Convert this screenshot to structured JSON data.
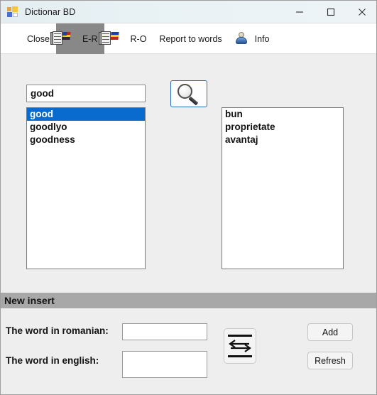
{
  "window": {
    "title": "Dictionar BD",
    "icon": "app-form-icon",
    "controls": {
      "minimize": "minimize-icon",
      "maximize": "maximize-icon",
      "close": "close-icon"
    }
  },
  "toolbar": {
    "items": [
      {
        "label": "Close",
        "icon": "power-icon",
        "selected": false
      },
      {
        "label": "E-R",
        "icon": "english-book-icon",
        "selected": true
      },
      {
        "label": "R-O",
        "icon": "romanian-book-icon",
        "selected": false
      },
      {
        "label": "Report to words",
        "icon": "",
        "selected": false
      },
      {
        "label": "Info",
        "icon": "person-icon",
        "selected": false
      }
    ]
  },
  "search": {
    "value": "good",
    "placeholder": "",
    "button_icon": "magnifier-icon"
  },
  "results": {
    "source_list": {
      "items": [
        "good",
        "goodlyo",
        "goodness"
      ],
      "selected_index": 0
    },
    "target_list": {
      "items": [
        "bun",
        "proprietate",
        "avantaj"
      ],
      "selected_index": -1
    }
  },
  "new_insert": {
    "section_title": "New insert",
    "romanian_label": "The word in romanian:",
    "romanian_value": "",
    "romanian_placeholder": "",
    "english_label": "The word in english:",
    "english_value": "",
    "english_placeholder": "",
    "swap_icon": "swap-arrows-icon",
    "add_label": "Add",
    "refresh_label": "Refresh"
  },
  "colors": {
    "titlebar": "#e9f2f5",
    "toolbar": "#ffffff",
    "selected_tab": "#888888",
    "body": "#eeeeee",
    "section_bar": "#a8a8a8",
    "selection": "#0a6bcf",
    "focus_border": "#2b6ab5"
  }
}
